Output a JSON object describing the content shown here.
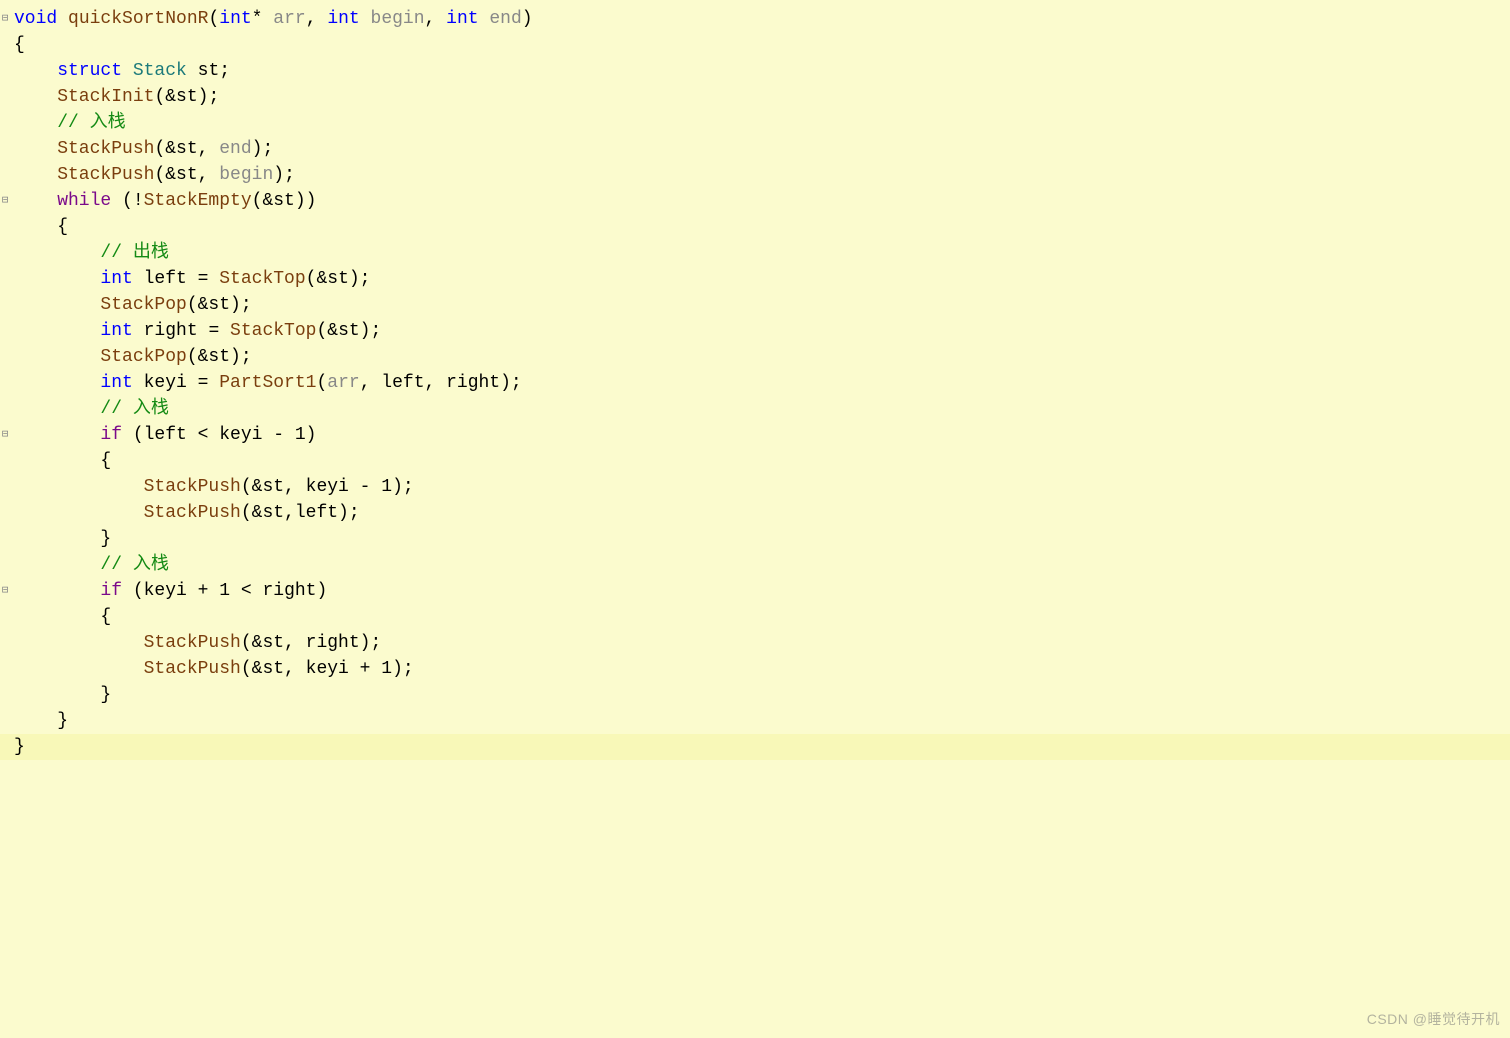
{
  "code": {
    "l1_void": "void",
    "l1_fn": " quickSortNonR",
    "l1_p1a": "(",
    "l1_int": "int",
    "l1_star": "*",
    "l1_arr": " arr",
    "l1_c1": ", ",
    "l1_int2": "int",
    "l1_begin": " begin",
    "l1_c2": ", ",
    "l1_int3": "int",
    "l1_end": " end",
    "l1_p1b": ")",
    "l2": "{",
    "l3_struct": "    struct",
    "l3_stack": " Stack",
    "l3_rest": " st;",
    "l4_fn": "    StackInit",
    "l4_rest": "(&st);",
    "l5": "",
    "l6": "    // 入栈",
    "l7_fn": "    StackPush",
    "l7_a": "(&st, ",
    "l7_p": "end",
    "l7_b": ");",
    "l8_fn": "    StackPush",
    "l8_a": "(&st, ",
    "l8_p": "begin",
    "l8_b": ");",
    "l9": "",
    "l10_while": "    while",
    "l10_a": " (!",
    "l10_fn": "StackEmpty",
    "l10_b": "(&st))",
    "l11": "    {",
    "l12": "        // 出栈",
    "l13_int": "        int",
    "l13_a": " left = ",
    "l13_fn": "StackTop",
    "l13_b": "(&st);",
    "l14_fn": "        StackPop",
    "l14_b": "(&st);",
    "l15_int": "        int",
    "l15_a": " right = ",
    "l15_fn": "StackTop",
    "l15_b": "(&st);",
    "l16_fn": "        StackPop",
    "l16_b": "(&st);",
    "l17": "",
    "l18_int": "        int",
    "l18_a": " keyi = ",
    "l18_fn": "PartSort1",
    "l18_b": "(",
    "l18_p": "arr",
    "l18_c": ", left, right);",
    "l19": "",
    "l20": "        // 入栈",
    "l21_if": "        if",
    "l21_a": " (left < keyi - ",
    "l21_n": "1",
    "l21_b": ")",
    "l22": "        {",
    "l23_fn": "            StackPush",
    "l23_a": "(&st, keyi - ",
    "l23_n": "1",
    "l23_b": ");",
    "l24_fn": "            StackPush",
    "l24_a": "(&st,left);",
    "l25": "        }",
    "l26": "",
    "l27": "        // 入栈",
    "l28_if": "        if",
    "l28_a": " (keyi + ",
    "l28_n": "1",
    "l28_b": " < right)",
    "l29": "        {",
    "l30_fn": "            StackPush",
    "l30_a": "(&st, right);",
    "l31_fn": "            StackPush",
    "l31_a": "(&st, keyi + ",
    "l31_n": "1",
    "l31_b": ");",
    "l32": "        }",
    "l33": "    }",
    "l34": "}"
  },
  "watermark": "CSDN @睡觉待开机"
}
